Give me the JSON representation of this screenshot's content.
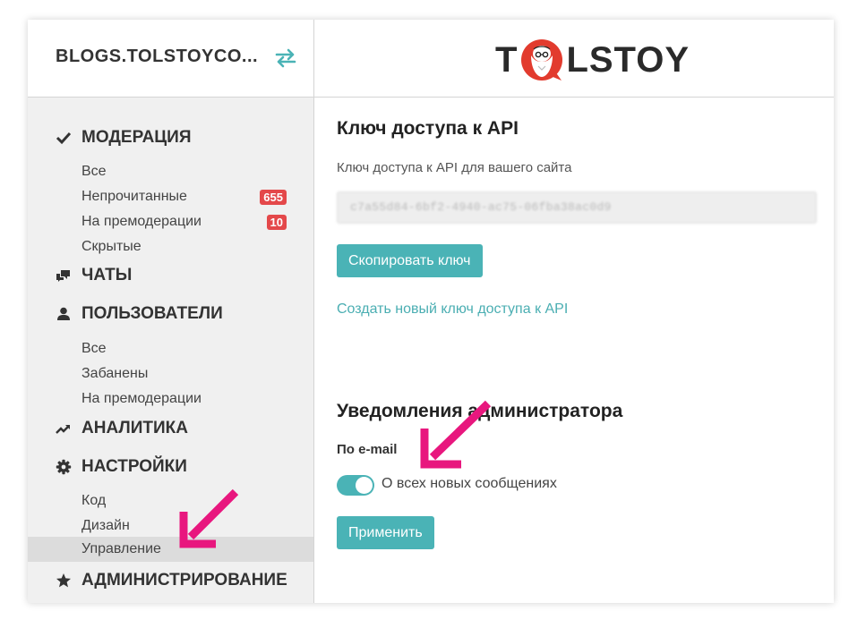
{
  "sidebar": {
    "site_name": "BLOGS.TOLSTOYCO...",
    "switch_icon": "swap-arrows-icon",
    "sections": [
      {
        "label": "МОДЕРАЦИЯ",
        "icon": "check-icon"
      },
      {
        "label": "ЧАТЫ",
        "icon": "chat-bubbles-icon"
      },
      {
        "label": "ПОЛЬЗОВАТЕЛИ",
        "icon": "user-icon"
      },
      {
        "label": "АНАЛИТИКА",
        "icon": "trend-chart-icon"
      },
      {
        "label": "НАСТРОЙКИ",
        "icon": "gear-icon"
      },
      {
        "label": "АДМИНИСТРИРОВАНИЕ",
        "icon": "star-icon"
      }
    ],
    "moderation_items": [
      {
        "label": "Все"
      },
      {
        "label": "Непрочитанные",
        "badge": "655"
      },
      {
        "label": "На премодерации",
        "badge": "10"
      },
      {
        "label": "Скрытые"
      }
    ],
    "users_items": [
      {
        "label": "Все"
      },
      {
        "label": "Забанены"
      },
      {
        "label": "На премодерации"
      }
    ],
    "settings_items": [
      {
        "label": "Код"
      },
      {
        "label": "Дизайн"
      },
      {
        "label": "Управление",
        "active": true
      }
    ]
  },
  "header": {
    "logo_text_left": "T",
    "logo_text_right": "LSTOY"
  },
  "api": {
    "title": "Ключ доступа к API",
    "description": "Ключ доступа к API для вашего сайта",
    "key_value": "c7a55d84-6bf2-4940-ac75-06fba38ac0d9",
    "copy_button": "Скопировать ключ",
    "new_key_link": "Создать новый ключ доступа к API"
  },
  "notifications": {
    "title": "Уведомления администратора",
    "email_label": "По e-mail",
    "toggle_label": "О всех новых сообщениях",
    "toggle_on": true,
    "apply_button": "Применить"
  },
  "colors": {
    "accent": "#4ab3b6",
    "badge": "#e4484a",
    "annotation_arrow": "#e8177e",
    "logo_red": "#e23b2e"
  }
}
